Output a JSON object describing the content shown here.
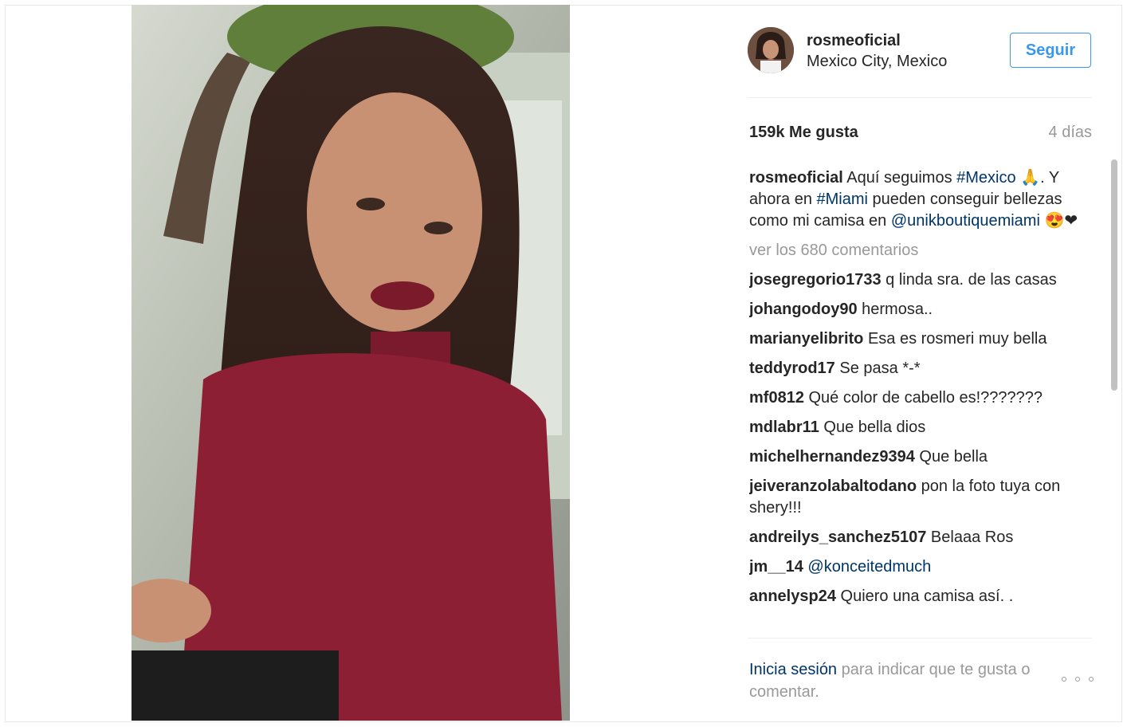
{
  "post": {
    "username": "rosmeoficial",
    "location": "Mexico City, Mexico",
    "follow_label": "Seguir",
    "likes": "159k Me gusta",
    "time": "4 días"
  },
  "caption": {
    "username": "rosmeoficial",
    "text_1": " Aquí seguimos ",
    "hashtag_1": "#Mexico",
    "emoji_1": " 🙏.",
    "text_2": " Y ahora en ",
    "hashtag_2": "#Miami",
    "text_3": " pueden conseguir bellezas como mi camisa en ",
    "mention": "@unikboutiquemiami",
    "emoji_2": " 😍❤"
  },
  "view_all": "ver los 680 comentarios",
  "comments": [
    {
      "user": "josegregorio1733",
      "text": " q linda sra. de las casas"
    },
    {
      "user": "johangodoy90",
      "text": " hermosa.."
    },
    {
      "user": "marianyelibrito",
      "text": " Esa es rosmeri muy bella"
    },
    {
      "user": "teddyrod17",
      "text": " Se pasa *-*"
    },
    {
      "user": "mf0812",
      "text": " Qué color de cabello es!???????"
    },
    {
      "user": "mdlabr11",
      "text": " Que bella dios"
    },
    {
      "user": "michelhernandez9394",
      "text": " Que bella"
    },
    {
      "user": "jeiveranzolabaltodano",
      "text": " pon la foto tuya con shery!!!"
    },
    {
      "user": "andreilys_sanchez5107",
      "text": " Belaaa Ros"
    },
    {
      "user": "jm__14",
      "text": " ",
      "mention": "@konceitedmuch"
    },
    {
      "user": "annelysp24",
      "text": " Quiero una camisa así. ."
    }
  ],
  "login": {
    "link": "Inicia sesión",
    "text": " para indicar que te gusta o comentar."
  },
  "colors": {
    "link": "#003569",
    "accent": "#3897f0",
    "muted": "#999999"
  }
}
